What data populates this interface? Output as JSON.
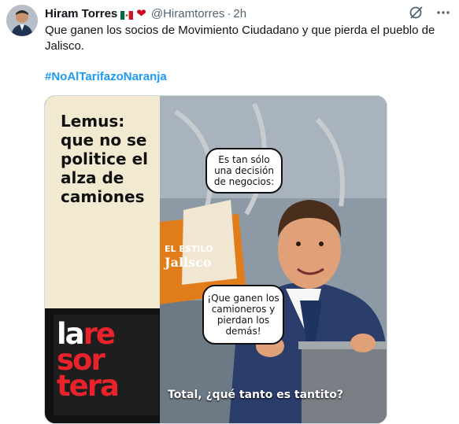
{
  "tweet": {
    "author_name": "Hiram Torres",
    "handle": "@Hiramtorres",
    "separator": "·",
    "time": "2h",
    "text": "Que ganen los socios de Movimiento Ciudadano y que pierda el pueblo de Jalisco.",
    "hashtag": "#NoAlTarifazoNaranja"
  },
  "icons": {
    "flag": "mexico-flag-icon",
    "heart": "heart-icon",
    "grok": "grok-icon",
    "more": "more-icon"
  },
  "image": {
    "headline": "Lemus: que no se politice el alza de camiones",
    "bubble_top": "Es tan sólo una decisión de negocios:",
    "bubble_mid": "¡Que ganen los camioneros y pierdan los demás!",
    "sign_top": "EL ESTILO",
    "sign_bottom": "Jalisco",
    "brand_line1_a": "la",
    "brand_line1_b": "re",
    "brand_line2": "sor",
    "brand_line3": "tera",
    "caption": "Total, ¿qué tanto es tantito?"
  },
  "colors": {
    "hashtag": "#1d9bf0",
    "brand_red": "#e8232b",
    "text": "#0f1419",
    "muted": "#536471"
  }
}
